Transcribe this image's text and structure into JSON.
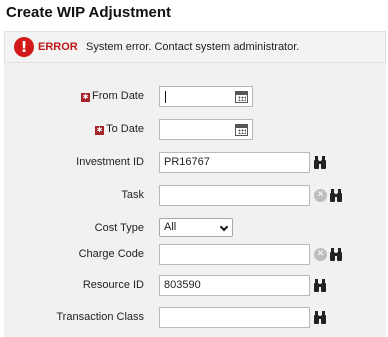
{
  "page": {
    "title": "Create WIP Adjustment"
  },
  "error": {
    "label": "ERROR",
    "message": "System error. Contact system administrator."
  },
  "form": {
    "from_date": {
      "label": "From Date",
      "value": "",
      "required": true
    },
    "to_date": {
      "label": "To Date",
      "value": "",
      "required": true
    },
    "investment_id": {
      "label": "Investment ID",
      "value": "PR16767"
    },
    "task": {
      "label": "Task",
      "value": ""
    },
    "cost_type": {
      "label": "Cost Type",
      "value": "All"
    },
    "charge_code": {
      "label": "Charge Code",
      "value": ""
    },
    "resource_id": {
      "label": "Resource ID",
      "value": "803590"
    },
    "transaction_class": {
      "label": "Transaction Class",
      "value": ""
    }
  },
  "icons": {
    "error": "exclamation-circle-icon",
    "required": "asterisk-icon",
    "calendar": "calendar-icon",
    "lookup": "binoculars-icon",
    "clear": "clear-x-icon"
  },
  "colors": {
    "error_red": "#c0181a",
    "required_marker": "#a5252a",
    "panel_bg": "#f1f1f1"
  }
}
